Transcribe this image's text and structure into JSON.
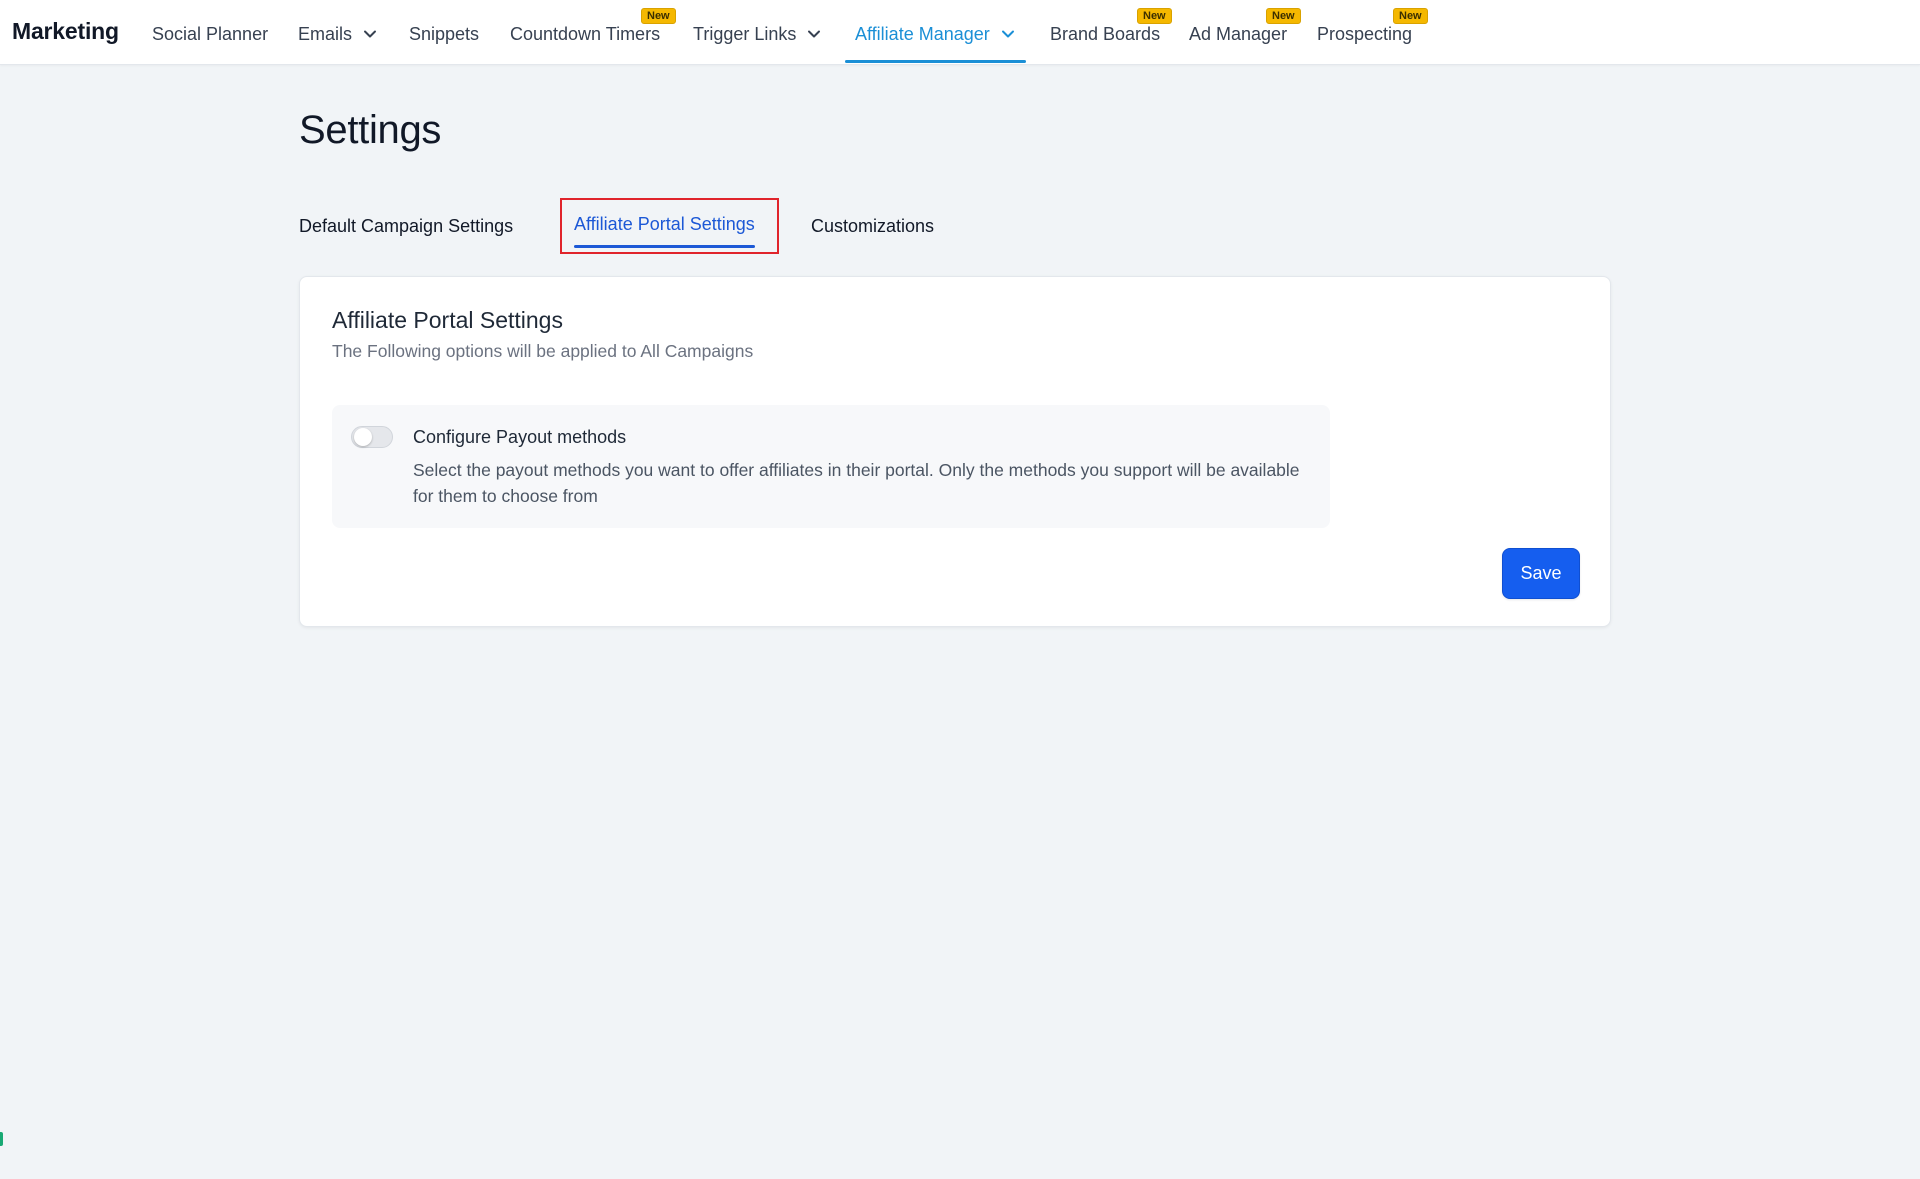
{
  "nav": {
    "brand": "Marketing",
    "items": [
      {
        "label": "Social Planner"
      },
      {
        "label": "Emails"
      },
      {
        "label": "Snippets"
      },
      {
        "label": "Countdown Timers",
        "badge": "New"
      },
      {
        "label": "Trigger Links"
      },
      {
        "label": "Affiliate Manager"
      },
      {
        "label": "Brand Boards",
        "badge": "New"
      },
      {
        "label": "Ad Manager",
        "badge": "New"
      },
      {
        "label": "Prospecting",
        "badge": "New"
      }
    ],
    "active_item": "Affiliate Manager",
    "accent_color": "#1b8fd6",
    "badge_color": "#f5b800"
  },
  "page": {
    "title": "Settings",
    "tabs": [
      {
        "label": "Default Campaign Settings"
      },
      {
        "label": "Affiliate Portal Settings"
      },
      {
        "label": "Customizations"
      }
    ],
    "selected_tab": "Affiliate Portal Settings"
  },
  "card": {
    "title": "Affiliate Portal Settings",
    "subtitle": "The Following options will be applied to All Campaigns",
    "option": {
      "title": "Configure Payout methods",
      "description": "Select the payout methods you want to offer affiliates in their portal. Only the methods you support will be available for them to choose from",
      "enabled": false
    },
    "save_label": "Save",
    "primary_color": "#155eef"
  }
}
